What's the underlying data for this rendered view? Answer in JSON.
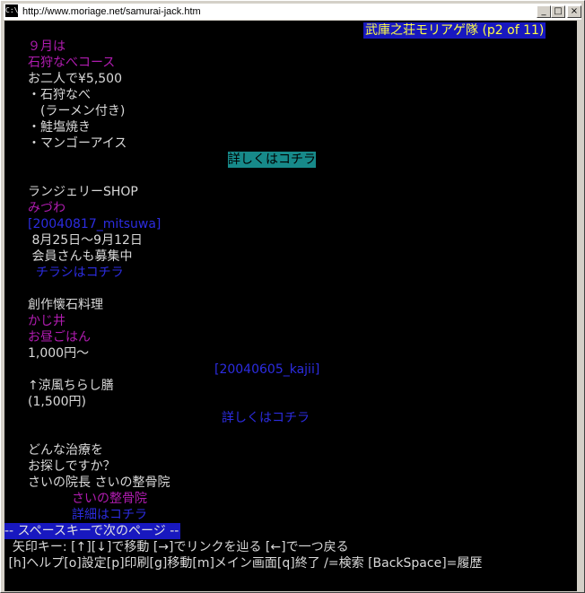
{
  "window": {
    "title": "http://www.moriage.net/samurai-jack.htm",
    "icon_label": "C:\\",
    "minimize_label": "_",
    "maximize_label": "□",
    "close_label": "×"
  },
  "status": {
    "page_title": "武庫之荘モリアゲ隊 (p2 of 11)"
  },
  "content": {
    "l1": "９月は",
    "l2": "石狩なべコース",
    "l3": "お二人で¥5,500",
    "l4": "・石狩なべ",
    "l5": "　(ラーメン付き)",
    "l6": "・鮭塩焼き",
    "l7": "・マンゴーアイス",
    "link1": "詳しくはコチラ",
    "l8": "ランジェリーSHOP",
    "l9": "みづわ",
    "link2": "[20040817_mitsuwa]",
    "l10": " 8月25日～9月12日",
    "l11": " 会員さんも募集中",
    "link3": "  チラシはコチラ",
    "l12": "創作懐石料理",
    "l13": "かじ井",
    "l14": "お昼ごはん",
    "l15": "1,000円～",
    "link4": "[20040605_kajii]",
    "l16": "↑涼風ちらし膳",
    "l17": "(1,500円)",
    "link5": "詳しくはコチラ",
    "l18": "どんな治療を",
    "l19": "お探しですか？",
    "l20": "さいの院長 さいの整骨院",
    "l21": "さいの整骨院",
    "link6": "詳細はコチラ"
  },
  "footer": {
    "message": "-- スペースキーで次のページ --",
    "help1": "  矢印キー: [↑][↓]で移動 [→]でリンクを辿る [←]で一つ戻る",
    "help2": " [h]ヘルプ[o]設定[p]印刷[g]移動[m]メイン画面[q]終了 /=検索 [BackSpace]=履歴"
  },
  "colors": {
    "background": "#000000",
    "text": "#d9d9d9",
    "visited_link": "#b01cb0",
    "link": "#2c2ce0",
    "highlight": "#178a8a",
    "status_bg": "#1818c0",
    "status_fg": "#ffff44"
  }
}
